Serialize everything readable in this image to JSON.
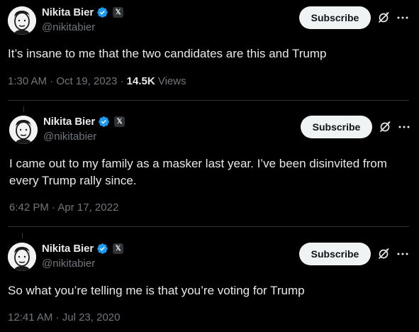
{
  "tweets": [
    {
      "name": "Nikita Bier",
      "handle": "@nikitabier",
      "subscribe_label": "Subscribe",
      "text": "It’s insane to me that the two candidates are this and Trump",
      "time": "1:30 AM",
      "date": "Oct 19, 2023",
      "views_count": "14.5K",
      "views_label": "Views"
    },
    {
      "name": "Nikita Bier",
      "handle": "@nikitabier",
      "subscribe_label": "Subscribe",
      "text": "I came out to my family as a masker last year. I’ve been disinvited from every Trump rally since.",
      "time": "6:42 PM",
      "date": "Apr 17, 2022"
    },
    {
      "name": "Nikita Bier",
      "handle": "@nikitabier",
      "subscribe_label": "Subscribe",
      "text": "So what you’re telling me is that you’re voting for Trump",
      "time": "12:41 AM",
      "date": "Jul 23, 2020"
    }
  ],
  "separator": "·",
  "x_badge_glyph": "𝕏",
  "colors": {
    "background": "#000000",
    "text": "#e7e9ea",
    "secondary": "#71767b",
    "verified": "#1d9bf0",
    "button_bg": "#eff3f4",
    "divider": "#2f3336"
  },
  "icons": [
    "verified-badge-icon",
    "x-affiliation-icon",
    "grok-icon",
    "more-icon"
  ]
}
